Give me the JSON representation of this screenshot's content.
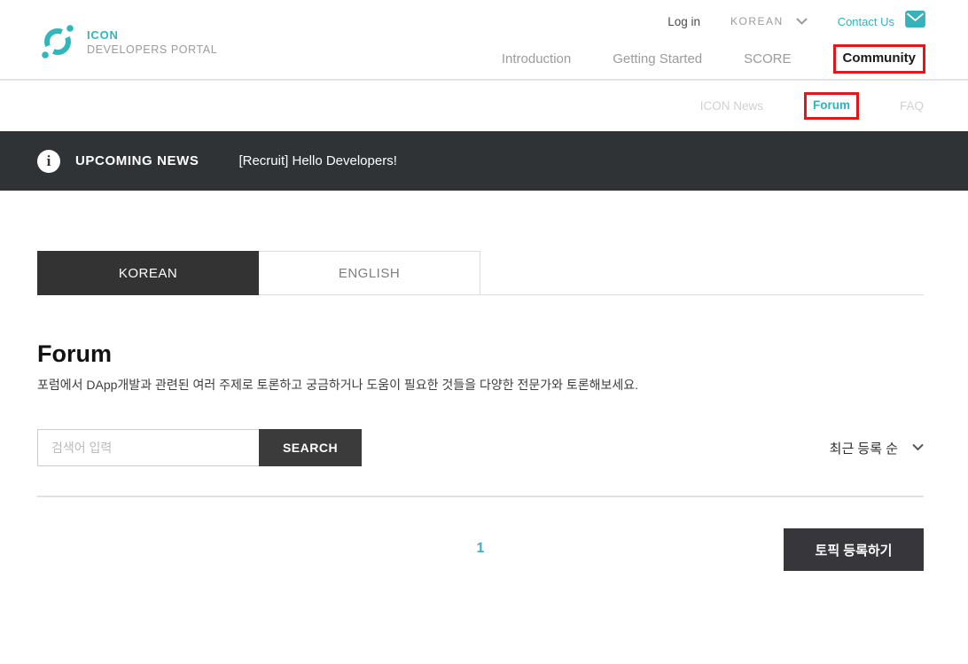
{
  "brand": {
    "name": "ICON",
    "subtitle": "DEVELOPERS PORTAL"
  },
  "topbar": {
    "login_label": "Log in",
    "language_value": "KOREAN",
    "contact_label": "Contact Us"
  },
  "nav": {
    "items": [
      {
        "label": "Introduction",
        "active": false
      },
      {
        "label": "Getting Started",
        "active": false
      },
      {
        "label": "SCORE",
        "active": false
      },
      {
        "label": "Community",
        "active": true,
        "annotated": true
      }
    ]
  },
  "subnav": {
    "items": [
      {
        "label": "ICON News",
        "active": false
      },
      {
        "label": "Forum",
        "active": true,
        "annotated": true
      },
      {
        "label": "FAQ",
        "active": false
      }
    ]
  },
  "banner": {
    "label": "UPCOMING NEWS",
    "title": "[Recruit] Hello Developers!"
  },
  "tabs": [
    {
      "label": "KOREAN",
      "active": true
    },
    {
      "label": "ENGLISH",
      "active": false
    }
  ],
  "forum": {
    "title": "Forum",
    "description": "포럼에서 DApp개발과 관련된 여러 주제로 토론하고 궁금하거나 도움이 필요한 것들을 다양한 전문가와 토론해보세요."
  },
  "search": {
    "placeholder": "검색어 입력",
    "button_label": "SEARCH"
  },
  "sort": {
    "value": "최근 등록 순"
  },
  "pagination": {
    "current": "1"
  },
  "actions": {
    "create_topic_label": "토픽 등록하기"
  },
  "icons": {
    "logo": "icon-ring-logo",
    "mail": "envelope-icon",
    "info": "info-icon",
    "chevron": "chevron-down-icon"
  },
  "colors": {
    "accent_teal": "#35b2ba",
    "banner_dark": "#2f3336",
    "button_dark": "#3b3b3b",
    "annotation_red": "#e2171b"
  }
}
